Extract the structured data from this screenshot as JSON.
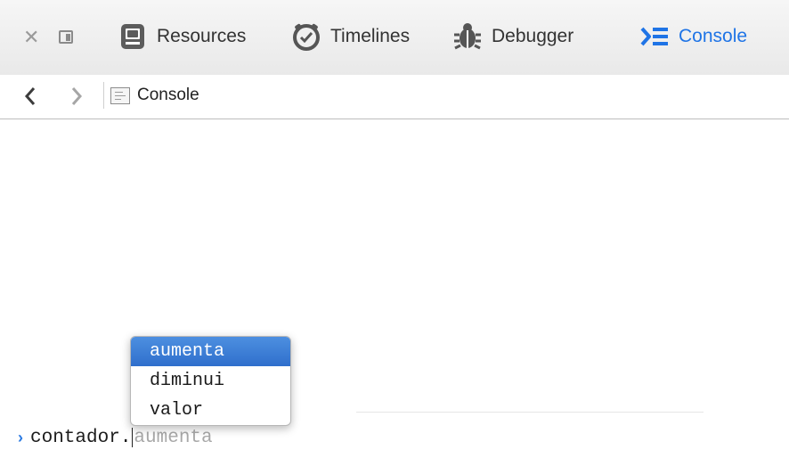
{
  "toolbar": {
    "close_icon": "close-icon",
    "dock_icon": "dock-toggle-icon",
    "tabs": [
      {
        "label": "Resources",
        "icon": "resources-icon",
        "active": false
      },
      {
        "label": "Timelines",
        "icon": "timelines-icon",
        "active": false
      },
      {
        "label": "Debugger",
        "icon": "debugger-icon",
        "active": false
      },
      {
        "label": "Console",
        "icon": "console-icon",
        "active": true
      }
    ],
    "accent_color": "#1f74e6"
  },
  "navigation": {
    "back_icon": "chevron-left-icon",
    "forward_icon": "chevron-right-icon",
    "breadcrumb": {
      "label": "Console",
      "icon": "console-log-icon"
    }
  },
  "console": {
    "prompt_text": "contador.",
    "ghost_completion": "aumenta",
    "completions": [
      {
        "label": "aumenta",
        "selected": true
      },
      {
        "label": "diminui",
        "selected": false
      },
      {
        "label": "valor",
        "selected": false
      }
    ]
  }
}
